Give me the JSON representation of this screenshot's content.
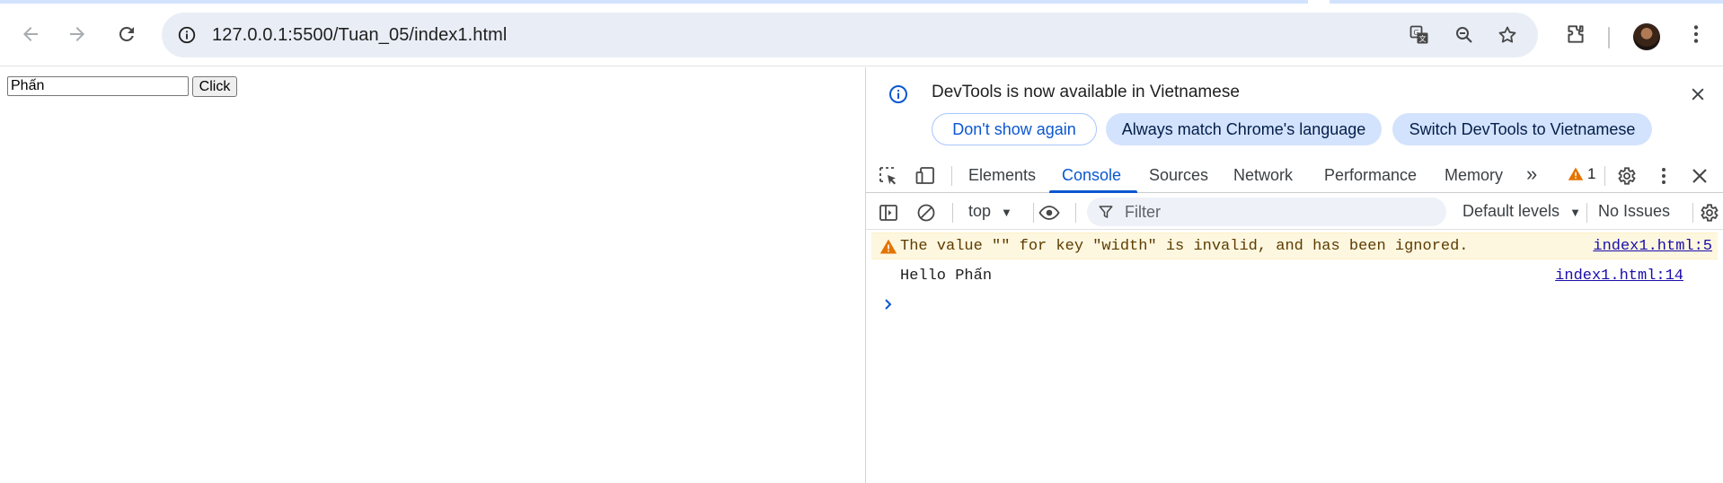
{
  "browser": {
    "url": "127.0.0.1:5500/Tuan_05/index1.html",
    "icons": [
      "back-icon",
      "forward-icon",
      "reload-icon",
      "site-info-icon",
      "translate-icon",
      "zoom-icon",
      "bookmark-star-icon",
      "extensions-icon",
      "profile-avatar",
      "more-menu-icon"
    ]
  },
  "page": {
    "input_value": "Phấn",
    "button_label": "Click"
  },
  "devtools": {
    "infobar": {
      "message": "DevTools is now available in Vietnamese",
      "dont_show": "Don't show again",
      "match_language": "Always match Chrome's language",
      "switch_language": "Switch DevTools to Vietnamese"
    },
    "tabs": [
      "Elements",
      "Console",
      "Sources",
      "Network",
      "Performance",
      "Memory"
    ],
    "active_tab": "Console",
    "more_tabs": "»",
    "warning_count": "1",
    "console": {
      "context": "top",
      "filter_placeholder": "Filter",
      "levels": "Default levels",
      "issues": "No Issues",
      "messages": [
        {
          "level": "warning",
          "text": "The value \"\" for key \"width\" is invalid, and has been ignored.",
          "source": "index1.html:5"
        },
        {
          "level": "log",
          "text": "Hello Phấn",
          "source": "index1.html:14"
        }
      ]
    }
  },
  "colors": {
    "accent": "#0b57d0",
    "warning_bg": "#fef7e0",
    "warning_icon": "#e37400",
    "omnibox_bg": "#e9eef6",
    "pill_bg": "#d3e3fd"
  }
}
